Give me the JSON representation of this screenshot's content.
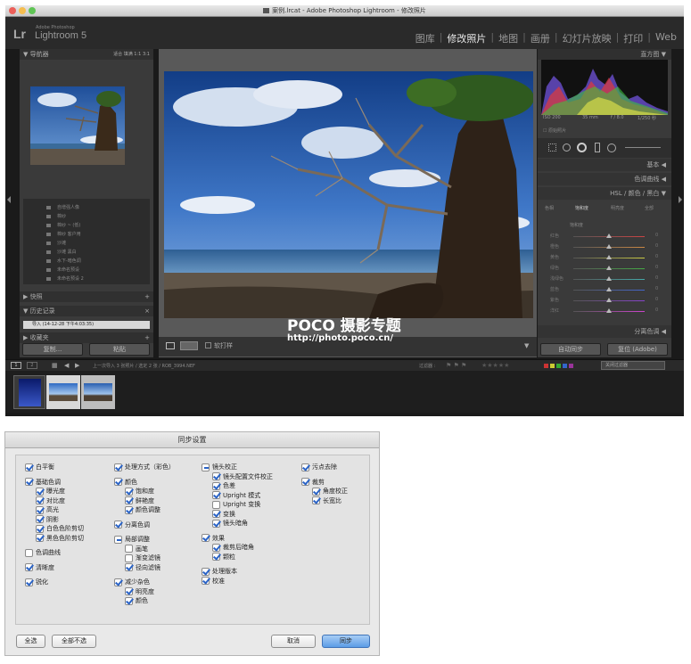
{
  "window": {
    "title": "案例.lrcat - Adobe Photoshop Lightroom - 修改照片"
  },
  "identity": {
    "mark": "Lr",
    "adobe": "Adobe Photoshop",
    "name": "Lightroom 5"
  },
  "modules": [
    "图库",
    "修改照片",
    "地图",
    "画册",
    "幻灯片放映",
    "打印",
    "Web"
  ],
  "module_active": "修改照片",
  "left_panel": {
    "navigator_title": "导航器",
    "navigator_opts": "适合  填满  1:1  3:1",
    "presets": [
      "自增强人像",
      "棉纱",
      "棉纱 ~ (低)",
      "棉纱 客户用",
      "沙滩",
      "沙滩 黑白",
      "水下-暗色调",
      "未命名预设",
      "未命名预设 2"
    ],
    "snapshots_title": "快照",
    "history_title": "历史记录",
    "history_entry": "导入 (14-12-28 下午4:03:35)",
    "collections_title": "收藏夹",
    "copy_button": "复制...",
    "paste_button": "粘贴"
  },
  "center": {
    "soft_proof": "软打样"
  },
  "watermark": {
    "brand": "POCO 摄影专题",
    "url": "http://photo.poco.cn/"
  },
  "right_panel": {
    "histogram_title": "直方图",
    "exif": {
      "iso": "ISO 200",
      "focal": "35 mm",
      "aperture": "f / 8.0",
      "shutter": "1/250 秒"
    },
    "original_photo": "原始照片",
    "basic": "基本",
    "tone_curve": "色调曲线",
    "hsl_header": "HSL / 颜色 / 黑白",
    "hsl_tabs": [
      "色相",
      "饱和度",
      "明亮度",
      "全部"
    ],
    "saturation_label": "饱和度",
    "sliders": [
      "红色",
      "橙色",
      "黄色",
      "绿色",
      "浅绿色",
      "蓝色",
      "紫色",
      "洋红"
    ],
    "slider_value": "0",
    "split_toning": "分离色调",
    "auto_sync": "自动同步",
    "reset": "复位 (Adobe)"
  },
  "filmstrip": {
    "source": "上一次导入",
    "count": "3 张照片 / 选定 2 张 / ROB_3994.NEF",
    "filter_label": "过滤器 :",
    "filter_value": "关闭过滤器"
  },
  "dialog": {
    "title": "同步设置",
    "columns": [
      [
        {
          "label": "白平衡",
          "state": "on",
          "indent": 0
        },
        {
          "label": "基础色调",
          "state": "on",
          "indent": 0,
          "gap": true
        },
        {
          "label": "曝光度",
          "state": "on",
          "indent": 1
        },
        {
          "label": "对比度",
          "state": "on",
          "indent": 1
        },
        {
          "label": "高光",
          "state": "on",
          "indent": 1
        },
        {
          "label": "阴影",
          "state": "on",
          "indent": 1
        },
        {
          "label": "白色色阶剪切",
          "state": "on",
          "indent": 1
        },
        {
          "label": "黑色色阶剪切",
          "state": "on",
          "indent": 1
        },
        {
          "label": "色调曲线",
          "state": "off",
          "indent": 0,
          "gap": true
        },
        {
          "label": "清晰度",
          "state": "on",
          "indent": 0,
          "gap": true
        },
        {
          "label": "锐化",
          "state": "on",
          "indent": 0,
          "gap": true
        }
      ],
      [
        {
          "label": "处理方式（彩色）",
          "state": "on",
          "indent": 0
        },
        {
          "label": "颜色",
          "state": "on",
          "indent": 0,
          "gap": true
        },
        {
          "label": "饱和度",
          "state": "on",
          "indent": 1
        },
        {
          "label": "鲜艳度",
          "state": "on",
          "indent": 1
        },
        {
          "label": "颜色调整",
          "state": "on",
          "indent": 1
        },
        {
          "label": "分离色调",
          "state": "on",
          "indent": 0,
          "gap": true
        },
        {
          "label": "局部调整",
          "state": "minus",
          "indent": 0,
          "gap": true
        },
        {
          "label": "画笔",
          "state": "off",
          "indent": 1
        },
        {
          "label": "渐变滤镜",
          "state": "off",
          "indent": 1
        },
        {
          "label": "径向滤镜",
          "state": "on",
          "indent": 1
        },
        {
          "label": "减少杂色",
          "state": "on",
          "indent": 0,
          "gap": true
        },
        {
          "label": "明亮度",
          "state": "on",
          "indent": 1
        },
        {
          "label": "颜色",
          "state": "on",
          "indent": 1
        }
      ],
      [
        {
          "label": "镜头校正",
          "state": "minus",
          "indent": 0
        },
        {
          "label": "镜头配置文件校正",
          "state": "on",
          "indent": 1
        },
        {
          "label": "色差",
          "state": "on",
          "indent": 1
        },
        {
          "label": "Upright 模式",
          "state": "on",
          "indent": 1
        },
        {
          "label": "Upright 变换",
          "state": "off",
          "indent": 1
        },
        {
          "label": "变换",
          "state": "on",
          "indent": 1
        },
        {
          "label": "镜头暗角",
          "state": "on",
          "indent": 1
        },
        {
          "label": "效果",
          "state": "on",
          "indent": 0,
          "gap": true
        },
        {
          "label": "裁剪后暗角",
          "state": "on",
          "indent": 1
        },
        {
          "label": "颗粒",
          "state": "on",
          "indent": 1
        },
        {
          "label": "处理版本",
          "state": "on",
          "indent": 0,
          "gap": true
        },
        {
          "label": "校准",
          "state": "on",
          "indent": 0
        }
      ],
      [
        {
          "label": "污点去除",
          "state": "on",
          "indent": 0
        },
        {
          "label": "裁剪",
          "state": "on",
          "indent": 0,
          "gap": true
        },
        {
          "label": "角度校正",
          "state": "on",
          "indent": 1
        },
        {
          "label": "长宽比",
          "state": "on",
          "indent": 1
        }
      ]
    ],
    "buttons": {
      "select_all": "全选",
      "select_none": "全部不选",
      "cancel": "取消",
      "sync": "同步"
    }
  },
  "colors": {
    "accent": "#2a63c6",
    "primary_button": "#5b9ce6"
  }
}
